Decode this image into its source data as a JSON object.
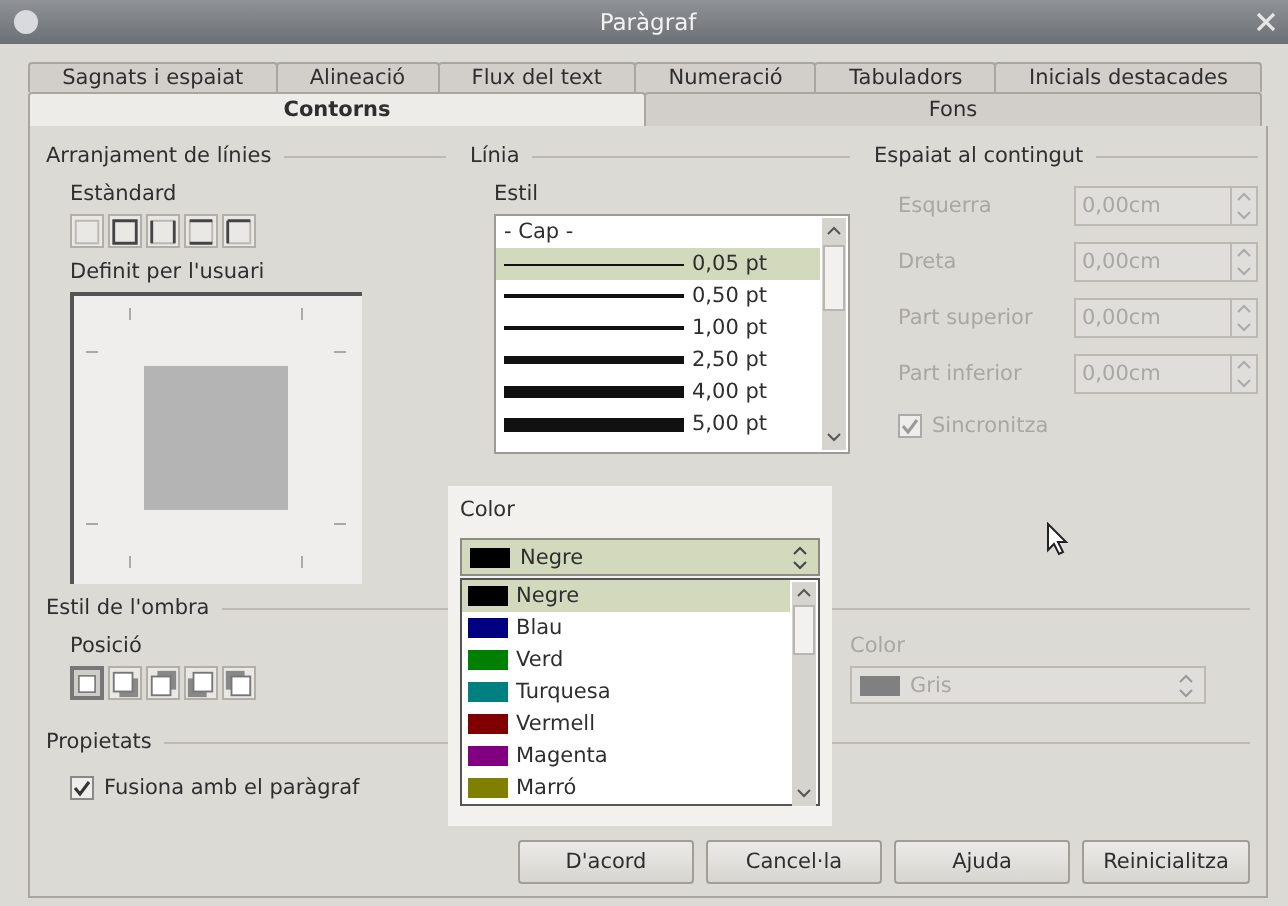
{
  "window": {
    "title": "Paràgraf"
  },
  "tab_rows": [
    [
      {
        "label": "Sagnats i espaiat",
        "selected": false
      },
      {
        "label": "Alineació",
        "selected": false
      },
      {
        "label": "Flux del text",
        "selected": false
      },
      {
        "label": "Numeració",
        "selected": false
      },
      {
        "label": "Tabuladors",
        "selected": false
      },
      {
        "label": "Inicials destacades",
        "selected": false
      }
    ],
    [
      {
        "label": "Contorns",
        "selected": true
      },
      {
        "label": "Fons",
        "selected": false
      }
    ]
  ],
  "line_arrangement": {
    "title": "Arranjament de línies",
    "default_label": "Estàndard",
    "presets": [
      {
        "kind": "none",
        "selected": false
      },
      {
        "kind": "box",
        "selected": false
      },
      {
        "kind": "sides",
        "selected": false
      },
      {
        "kind": "topbottom",
        "selected": false
      },
      {
        "kind": "left",
        "selected": false
      }
    ],
    "user_label": "Definit per l'usuari"
  },
  "line": {
    "title": "Línia",
    "style_label": "Estil",
    "styles": [
      {
        "label": "- Cap -",
        "kind": "none",
        "selected": false
      },
      {
        "label": "0,05 pt",
        "kind": "hairline",
        "selected": true
      },
      {
        "label": "0,50 pt",
        "kind": "thin",
        "selected": false
      },
      {
        "label": "1,00 pt",
        "kind": "medium",
        "selected": false
      },
      {
        "label": "2,50 pt",
        "kind": "thick",
        "selected": false
      },
      {
        "label": "4,00 pt",
        "kind": "heavy",
        "selected": false
      },
      {
        "label": "5,00 pt",
        "kind": "extraheavy",
        "selected": false
      }
    ]
  },
  "spacing": {
    "title": "Espaiat al contingut",
    "fields": [
      {
        "label": "Esquerra",
        "value": "0,00cm",
        "disabled": true
      },
      {
        "label": "Dreta",
        "value": "0,00cm",
        "disabled": true
      },
      {
        "label": "Part superior",
        "value": "0,00cm",
        "disabled": true
      },
      {
        "label": "Part inferior",
        "value": "0,00cm",
        "disabled": true
      }
    ],
    "sync": {
      "label": "Sincronitza",
      "checked": true,
      "disabled": true
    }
  },
  "color_popup": {
    "label": "Color",
    "value": "Negre",
    "options": [
      {
        "label": "Negre",
        "color": "#000000",
        "selected": true
      },
      {
        "label": "Blau",
        "color": "#000080",
        "selected": false
      },
      {
        "label": "Verd",
        "color": "#008000",
        "selected": false
      },
      {
        "label": "Turquesa",
        "color": "#008080",
        "selected": false
      },
      {
        "label": "Vermell",
        "color": "#800000",
        "selected": false
      },
      {
        "label": "Magenta",
        "color": "#800080",
        "selected": false
      },
      {
        "label": "Marró",
        "color": "#808000",
        "selected": false
      }
    ]
  },
  "shadow": {
    "title": "Estil de l'ombra",
    "position_label": "Posició",
    "positions": [
      {
        "kind": "none",
        "selected": true
      },
      {
        "kind": "br",
        "selected": false
      },
      {
        "kind": "tr",
        "selected": false
      },
      {
        "kind": "bl",
        "selected": false
      },
      {
        "kind": "tl",
        "selected": false
      }
    ],
    "color_label": "Color",
    "color_value": "Gris",
    "color": "#808080",
    "disabled": true
  },
  "properties": {
    "title": "Propietats",
    "merge": {
      "label": "Fusiona amb el paràgraf",
      "checked": true
    }
  },
  "buttons": [
    "D'acord",
    "Cancel·la",
    "Ajuda",
    "Reinicialitza"
  ]
}
